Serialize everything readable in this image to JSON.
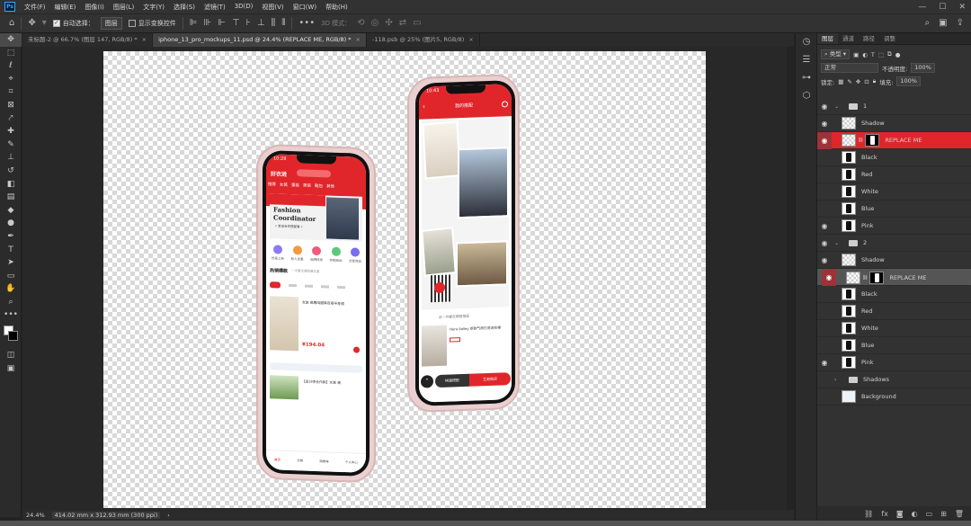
{
  "app": {
    "logo": "Ps"
  },
  "menu": [
    "文件(F)",
    "编辑(E)",
    "图像(I)",
    "图层(L)",
    "文字(Y)",
    "选择(S)",
    "滤镜(T)",
    "3D(D)",
    "视图(V)",
    "窗口(W)",
    "帮助(H)"
  ],
  "window_controls": [
    "—",
    "☐",
    "✕"
  ],
  "options_bar": {
    "auto_select_label": "自动选择：",
    "auto_select_value": "图层",
    "show_transform_label": "显示变换控件",
    "mode_3d_label": "3D 模式："
  },
  "tabs": [
    {
      "label": "未标题-2 @ 66.7% (图层 147, RGB/8) *",
      "close": "×"
    },
    {
      "label": "iphone_13_pro_mockups_11.psd @ 24.4% (REPLACE ME, RGB/8) *",
      "close": "×"
    },
    {
      "label": "-118.psb @ 25% (图片5, RGB/8)",
      "close": "×"
    }
  ],
  "status": {
    "zoom": "24.4%",
    "dimensions": "414.02 mm x 312.93 mm (300 ppi)"
  },
  "panel": {
    "tabs": [
      "图层",
      "通道",
      "路径",
      "调整"
    ],
    "filter_label": "类型",
    "blend_mode": "正常",
    "opacity_label": "不透明度:",
    "opacity_value": "100%",
    "lock_label": "锁定:",
    "fill_label": "填充:",
    "fill_value": "100%"
  },
  "layers": [
    {
      "name": "1",
      "kind": "group",
      "visible": true
    },
    {
      "name": "Shadow",
      "kind": "check",
      "visible": true
    },
    {
      "name": "REPLACE ME",
      "kind": "smart",
      "visible": true,
      "selected": false,
      "red": true
    },
    {
      "name": "Black",
      "kind": "phone",
      "visible": false
    },
    {
      "name": "Red",
      "kind": "phone",
      "visible": false
    },
    {
      "name": "White",
      "kind": "phone",
      "visible": false
    },
    {
      "name": "Blue",
      "kind": "phone",
      "visible": false
    },
    {
      "name": "Pink",
      "kind": "phone",
      "visible": true
    },
    {
      "name": "2",
      "kind": "group",
      "visible": true
    },
    {
      "name": "Shadow",
      "kind": "check",
      "visible": true
    },
    {
      "name": "REPLACE ME",
      "kind": "smart",
      "visible": true,
      "selected": true,
      "red": true
    },
    {
      "name": "Black",
      "kind": "phone",
      "visible": false
    },
    {
      "name": "Red",
      "kind": "phone",
      "visible": false
    },
    {
      "name": "White",
      "kind": "phone",
      "visible": false
    },
    {
      "name": "Blue",
      "kind": "phone",
      "visible": false
    },
    {
      "name": "Pink",
      "kind": "phone",
      "visible": true
    },
    {
      "name": "Shadows",
      "kind": "group",
      "visible": false
    },
    {
      "name": "Background",
      "kind": "bg",
      "visible": false
    }
  ],
  "phone1": {
    "time": "10:28",
    "app_title": "好衣进",
    "nav": [
      "推荐",
      "女装",
      "童装",
      "男装",
      "鞋包",
      "其他"
    ],
    "banner_line1": "Fashion",
    "banner_line2": "Coordinator",
    "banner_sub": "• 幸运合作搭配事 •",
    "icons": [
      "热爱上新",
      "新人优惠",
      "品牌特卖",
      "热销商品",
      "全部商品"
    ],
    "section_title": "热销爆款",
    "section_sub": "一次最优爆款最实惠",
    "product_name": "女装 高腰阔腿裤百搭半身裙",
    "price": "¥194.04",
    "product2": "【设计师合作款】女装 潮",
    "bottom_nav": [
      "首页",
      "分类",
      "购物车",
      "个人中心"
    ]
  },
  "phone2": {
    "time": "10:43",
    "header": "我的搭配",
    "caption": "这一件都在精搭搭配",
    "product": "Hera Valley 新款气质打底连衣裙",
    "btn_left": "快速搭配",
    "btn_right": "立刻购买"
  },
  "colors": {
    "ps_bg": "#232323",
    "accent_red": "#e0262b",
    "phone_pink": "#e9cfcf",
    "selection_red": "#9b3338"
  }
}
